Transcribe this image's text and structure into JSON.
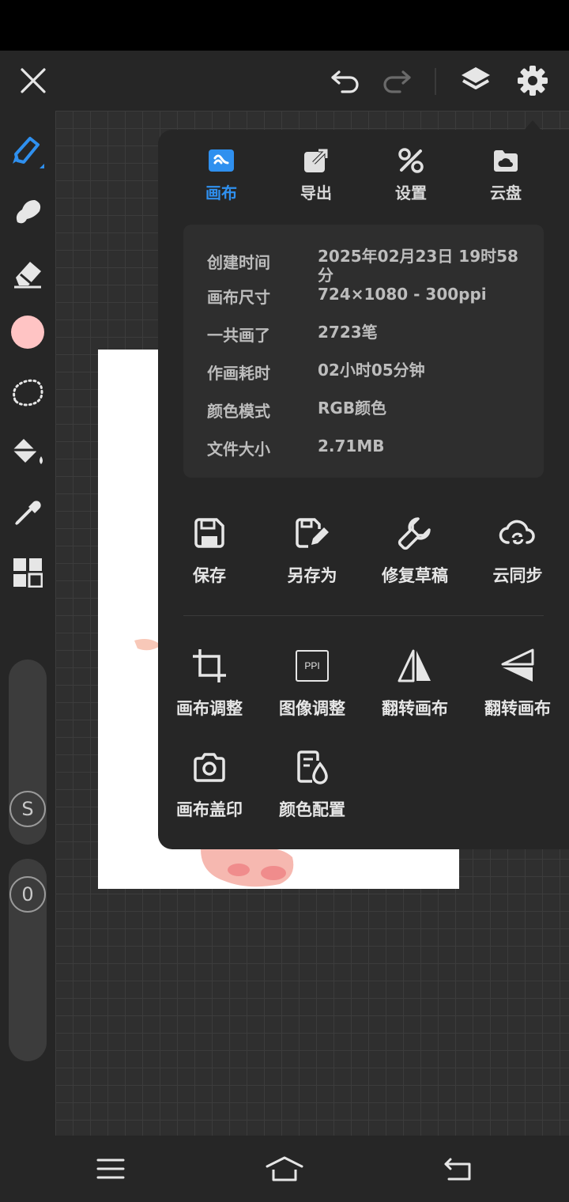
{
  "colors": {
    "accent": "#2f90ef",
    "panel_bg": "#262626",
    "card_bg": "#2e2e2e",
    "canvas_bg": "#2f2f2f",
    "brush_color": "#ffc4c4",
    "icon_fg": "#e6e6e6"
  },
  "top_toolbar": {
    "icons": [
      "close-icon",
      "undo-icon",
      "redo-icon",
      "layers-icon",
      "gear-icon"
    ]
  },
  "left_toolbar": {
    "tools": [
      "pen-icon",
      "smudge-icon",
      "eraser-icon",
      "color-swatch",
      "lasso-icon",
      "fill-bucket-icon",
      "eyedropper-icon",
      "grid-icon"
    ],
    "size_slider_label": "S",
    "opacity_slider_label": "0"
  },
  "panel": {
    "tabs": [
      {
        "label": "画布",
        "icon": "canvas-icon",
        "active": true
      },
      {
        "label": "导出",
        "icon": "export-icon",
        "active": false
      },
      {
        "label": "设置",
        "icon": "tools-icon",
        "active": false
      },
      {
        "label": "云盘",
        "icon": "cloud-folder-icon",
        "active": false
      }
    ],
    "info": [
      {
        "key": "创建时间",
        "value": "2025年02月23日 19时58分"
      },
      {
        "key": "画布尺寸",
        "value": "724×1080 - 300ppi"
      },
      {
        "key": "一共画了",
        "value": "2723笔"
      },
      {
        "key": "作画耗时",
        "value": "02小时05分钟"
      },
      {
        "key": "颜色模式",
        "value": "RGB颜色"
      },
      {
        "key": "文件大小",
        "value": "2.71MB"
      }
    ],
    "actions_row1": [
      {
        "label": "保存",
        "icon": "save-icon"
      },
      {
        "label": "另存为",
        "icon": "save-as-icon"
      },
      {
        "label": "修复草稿",
        "icon": "wrench-icon"
      },
      {
        "label": "云同步",
        "icon": "cloud-sync-icon"
      }
    ],
    "actions_row2": [
      {
        "label": "画布调整",
        "icon": "crop-icon"
      },
      {
        "label": "图像调整",
        "icon": "ppi-icon",
        "icon_text": "PPI"
      },
      {
        "label": "翻转画布",
        "icon": "flip-horizontal-icon"
      },
      {
        "label": "翻转画布",
        "icon": "flip-vertical-icon"
      }
    ],
    "actions_row3": [
      {
        "label": "画布盖印",
        "icon": "camera-icon"
      },
      {
        "label": "颜色配置",
        "icon": "color-profile-icon"
      }
    ]
  },
  "nav_bar": {
    "icons": [
      "menu-icon",
      "home-icon",
      "back-icon"
    ]
  }
}
